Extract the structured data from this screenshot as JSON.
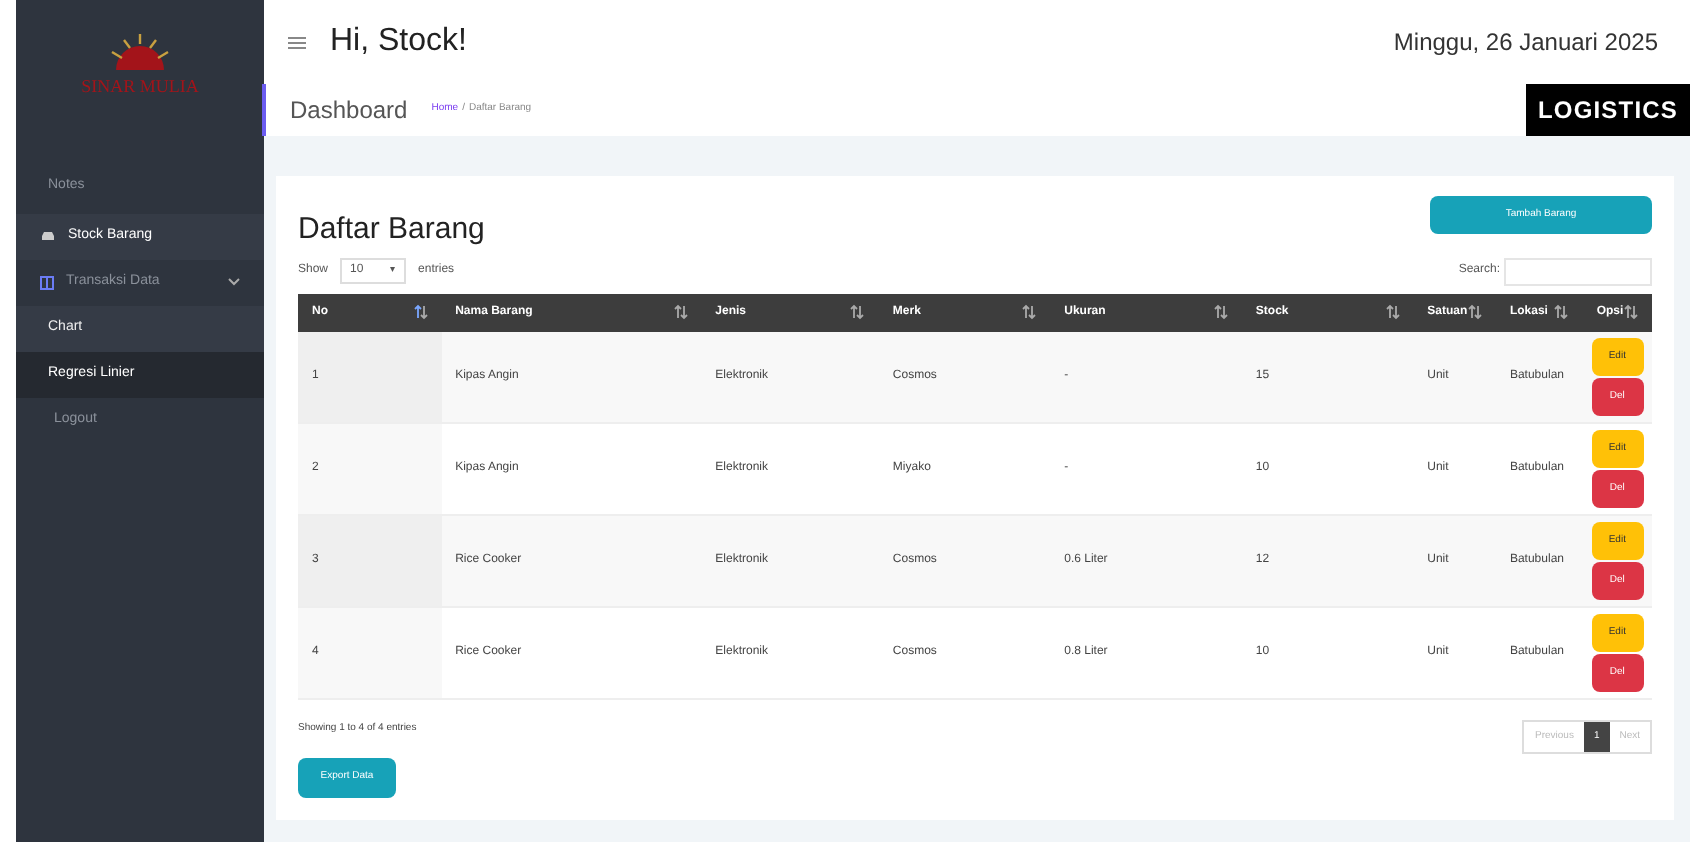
{
  "sidebar": {
    "logo": "SINAR MULIA",
    "heading": "Notes",
    "items": [
      {
        "label": "Stock Barang",
        "kind": "stock",
        "selected": true
      },
      {
        "label": "Transaksi Data",
        "kind": "data",
        "selected": false,
        "expanded": true,
        "children": [
          {
            "label": "Chart",
            "selected": false
          },
          {
            "label": "Regresi Linier",
            "selected": true
          }
        ]
      },
      {
        "label": "Logout",
        "kind": "plain",
        "selected": false
      }
    ]
  },
  "header": {
    "greeting": "Hi, Stock!",
    "date": "Minggu, 26 Januari 2025",
    "page_title": "Dashboard",
    "breadcrumb": [
      "Home",
      "/",
      "Daftar Barang"
    ],
    "brand": "LOGISTICS"
  },
  "card": {
    "title": "Daftar Barang",
    "add_button": "Tambah Barang",
    "show_label": "Show",
    "entries_value": "10",
    "entries_caret": "▾",
    "entries_label": "entries",
    "search_label": "Search:",
    "columns": [
      {
        "label": "No",
        "sorted": true
      },
      {
        "label": "Nama Barang",
        "sorted": false
      },
      {
        "label": "Jenis",
        "sorted": false
      },
      {
        "label": "Merk",
        "sorted": false
      },
      {
        "label": "Ukuran",
        "sorted": false
      },
      {
        "label": "Stock",
        "sorted": false
      },
      {
        "label": "Satuan",
        "sorted": false
      },
      {
        "label": "Lokasi",
        "sorted": false
      },
      {
        "label": "Opsi",
        "sorted": false
      }
    ],
    "rows": [
      {
        "cells": [
          "1",
          "Kipas Angin",
          "Elektronik",
          "Cosmos",
          "-",
          "15",
          "Unit",
          "Batubulan"
        ],
        "actions": [
          "Edit",
          "Del"
        ]
      },
      {
        "cells": [
          "2",
          "Kipas Angin",
          "Elektronik",
          "Miyako",
          "-",
          "10",
          "Unit",
          "Batubulan"
        ],
        "actions": [
          "Edit",
          "Del"
        ]
      },
      {
        "cells": [
          "3",
          "Rice Cooker",
          "Elektronik",
          "Cosmos",
          "0.6 Liter",
          "12",
          "Unit",
          "Batubulan"
        ],
        "actions": [
          "Edit",
          "Del"
        ]
      },
      {
        "cells": [
          "4",
          "Rice Cooker",
          "Elektronik",
          "Cosmos",
          "0.8 Liter",
          "10",
          "Unit",
          "Batubulan"
        ],
        "actions": [
          "Edit",
          "Del"
        ]
      }
    ],
    "info": "Showing 1 to 4 of 4 entries",
    "pagination": [
      {
        "label": "Previous",
        "selected": false,
        "disabled": true
      },
      {
        "label": "1",
        "selected": true,
        "disabled": false
      },
      {
        "label": "Next",
        "selected": false,
        "disabled": true
      }
    ],
    "export_button": "Export Data"
  }
}
